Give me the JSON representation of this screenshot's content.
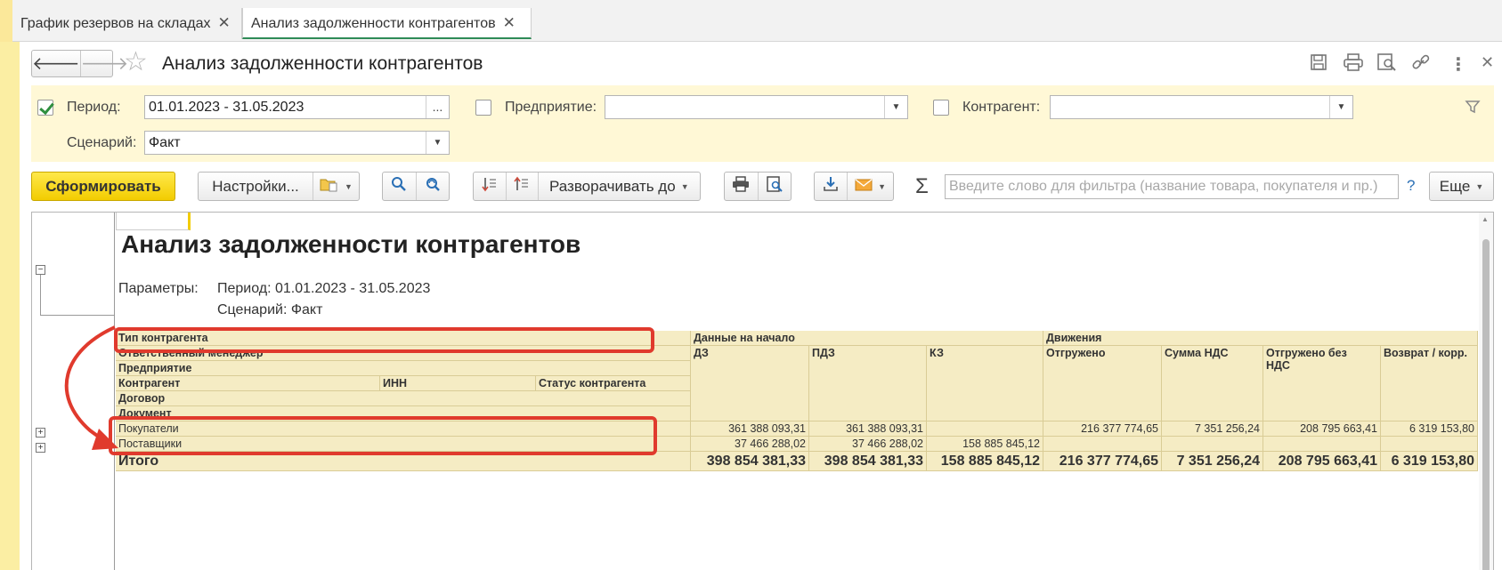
{
  "tabs": [
    {
      "label": "График резервов на складах",
      "active": false
    },
    {
      "label": "Анализ задолженности контрагентов",
      "active": true
    }
  ],
  "header": {
    "title": "Анализ задолженности контрагентов"
  },
  "filters": {
    "period_label": "Период:",
    "period_value": "01.01.2023 - 31.05.2023",
    "period_checked": true,
    "enterprise_label": "Предприятие:",
    "enterprise_value": "",
    "contractor_label": "Контрагент:",
    "contractor_value": "",
    "scenario_label": "Сценарий:",
    "scenario_value": "Факт"
  },
  "toolbar": {
    "generate_label": "Сформировать",
    "settings_label": "Настройки...",
    "expand_label": "Разворачивать до",
    "search_placeholder": "Введите слово для фильтра (название товара, покупателя и пр.)",
    "help_label": "?",
    "more_label": "Еще",
    "sum_symbol": "Σ"
  },
  "report": {
    "title": "Анализ задолженности контрагентов",
    "params_label": "Параметры:",
    "param_period": "Период: 01.01.2023 - 31.05.2023",
    "param_scenario": "Сценарий: Факт",
    "headers": {
      "contractor_type": "Тип контрагента",
      "manager": "Ответственный менеджер",
      "enterprise": "Предприятие",
      "contractor": "Контрагент",
      "inn": "ИНН",
      "status": "Статус контрагента",
      "contract": "Договор",
      "document": "Документ",
      "start_data": "Данные на начало",
      "movements": "Движения",
      "dz": "ДЗ",
      "pdz": "ПДЗ",
      "kz": "КЗ",
      "shipped": "Отгружено",
      "vat": "Сумма НДС",
      "shipped_no_vat": "Отгружено без НДС",
      "returns": "Возврат / корр."
    },
    "rows": [
      {
        "name": "Покупатели",
        "dz": "361 388 093,31",
        "pdz": "361 388 093,31",
        "kz": "",
        "shipped": "216 377 774,65",
        "vat": "7 351 256,24",
        "shipped_no_vat": "208 795 663,41",
        "returns": "6 319 153,80"
      },
      {
        "name": "Поставщики",
        "dz": "37 466 288,02",
        "pdz": "37 466 288,02",
        "kz": "158 885 845,12",
        "shipped": "",
        "vat": "",
        "shipped_no_vat": "",
        "returns": ""
      }
    ],
    "total": {
      "name": "Итого",
      "dz": "398 854 381,33",
      "pdz": "398 854 381,33",
      "kz": "158 885 845,12",
      "shipped": "216 377 774,65",
      "vat": "7 351 256,24",
      "shipped_no_vat": "208 795 663,41",
      "returns": "6 319 153,80"
    }
  },
  "colors": {
    "accent": "#f2cc00",
    "highlight": "#e03a2d",
    "table_bg": "#f5ecc4"
  }
}
